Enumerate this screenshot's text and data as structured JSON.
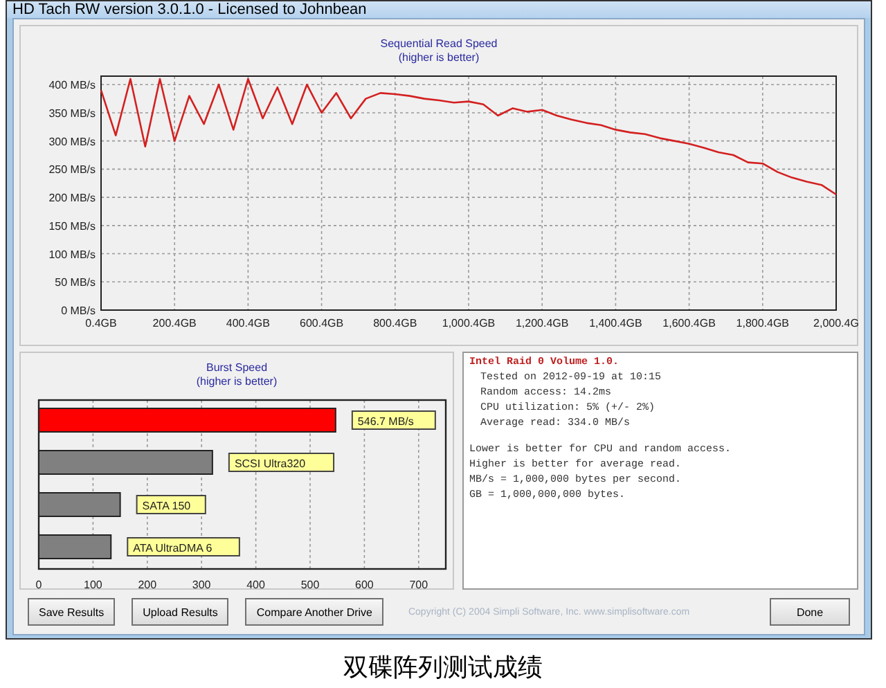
{
  "window": {
    "title": "HD Tach RW version 3.0.1.0 - Licensed to Johnbean"
  },
  "sequential": {
    "chart_data": {
      "type": "line",
      "title": "Sequential Read Speed",
      "subtitle": "(higher is better)",
      "x": [
        0.4,
        40.4,
        80.4,
        120.4,
        160.4,
        200.4,
        240.4,
        280.4,
        320.4,
        360.4,
        400.4,
        440.4,
        480.4,
        520.4,
        560.4,
        600.4,
        640.4,
        680.4,
        720.4,
        760.4,
        800.4,
        840.4,
        880.4,
        920.4,
        960.4,
        1000.4,
        1040.4,
        1080.4,
        1120.4,
        1160.4,
        1200.4,
        1240.4,
        1280.4,
        1320.4,
        1360.4,
        1400.4,
        1440.4,
        1480.4,
        1520.4,
        1560.4,
        1600.4,
        1640.4,
        1680.4,
        1720.4,
        1760.4,
        1800.4,
        1840.4,
        1880.4,
        1920.4,
        1960.4,
        2000.4
      ],
      "grid": true,
      "series": [
        {
          "color": "#d42020",
          "values": [
            390,
            310,
            410,
            290,
            410,
            300,
            380,
            330,
            400,
            320,
            410,
            340,
            395,
            330,
            400,
            350,
            385,
            340,
            375,
            385,
            383,
            380,
            375,
            372,
            368,
            370,
            365,
            345,
            358,
            352,
            355,
            345,
            338,
            332,
            328,
            320,
            315,
            312,
            305,
            300,
            295,
            288,
            280,
            275,
            262,
            260,
            245,
            235,
            228,
            222,
            205
          ]
        }
      ],
      "xlim": [
        0.4,
        2000.4
      ],
      "ylim": [
        0,
        415
      ],
      "xticks": [
        {
          "value": 0.4,
          "label": "0.4GB"
        },
        {
          "value": 200.4,
          "label": "200.4GB"
        },
        {
          "value": 400.4,
          "label": "400.4GB"
        },
        {
          "value": 600.4,
          "label": "600.4GB"
        },
        {
          "value": 800.4,
          "label": "800.4GB"
        },
        {
          "value": 1000.4,
          "label": "1,000.4GB"
        },
        {
          "value": 1200.4,
          "label": "1,200.4GB"
        },
        {
          "value": 1400.4,
          "label": "1,400.4GB"
        },
        {
          "value": 1600.4,
          "label": "1,600.4GB"
        },
        {
          "value": 1800.4,
          "label": "1,800.4GB"
        },
        {
          "value": 2000.4,
          "label": "2,000.4G"
        }
      ],
      "yticks": [
        {
          "value": 0,
          "label": "0 MB/s"
        },
        {
          "value": 50,
          "label": "50 MB/s"
        },
        {
          "value": 100,
          "label": "100 MB/s"
        },
        {
          "value": 150,
          "label": "150 MB/s"
        },
        {
          "value": 200,
          "label": "200 MB/s"
        },
        {
          "value": 250,
          "label": "250 MB/s"
        },
        {
          "value": 300,
          "label": "300 MB/s"
        },
        {
          "value": 350,
          "label": "350 MB/s"
        },
        {
          "value": 400,
          "label": "400 MB/s"
        }
      ]
    }
  },
  "burst": {
    "chart_data": {
      "type": "bar",
      "orientation": "horizontal",
      "stacked": true,
      "title": "Burst Speed",
      "subtitle": "(higher is better)",
      "categories": [
        "546.7 MB/s",
        "SCSI Ultra320",
        "SATA 150",
        "ATA UltraDMA 6"
      ],
      "series": [
        {
          "color": "#ff0000",
          "values": [
            547,
            null,
            null,
            null
          ]
        },
        {
          "color": "#808080",
          "values": [
            null,
            320,
            150,
            133
          ]
        }
      ],
      "xlim": [
        0,
        750
      ],
      "xticks": [
        0,
        100,
        200,
        300,
        400,
        500,
        600,
        700
      ],
      "grid": true
    }
  },
  "info": {
    "drive": "Intel Raid 0 Volume 1.0.",
    "details": [
      "Tested on 2012-09-19 at 10:15",
      "Random access: 14.2ms",
      "CPU utilization: 5% (+/- 2%)",
      "Average read: 334.0 MB/s"
    ],
    "notes": [
      "Lower is better for CPU and random access.",
      "Higher is better for average read.",
      "MB/s = 1,000,000 bytes per second.",
      "GB = 1,000,000,000 bytes."
    ]
  },
  "buttons": [
    "Save Results",
    "Upload Results",
    "Compare Another Drive"
  ],
  "copyright": "Copyright (C) 2004 Simpli Software, Inc. www.simplisoftware.com",
  "done_button": "Done",
  "caption": "双碟阵列测试成绩"
}
